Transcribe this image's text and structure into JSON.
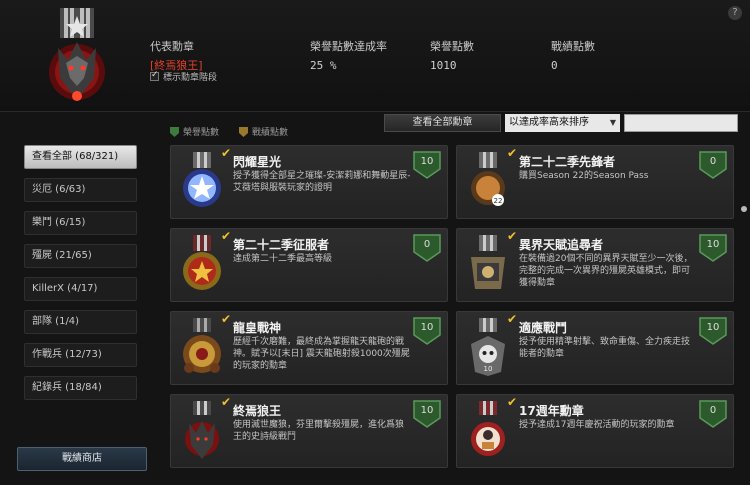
{
  "help": {
    "label": "?"
  },
  "header": {
    "rep_label": "代表勳章",
    "rep_name": "[終焉狼王]",
    "show_level_label": "標示勳章階段",
    "rate_label": "榮譽點數達成率",
    "rate_value": "25 %",
    "points_label": "榮譽點數",
    "points_value": "1010",
    "record_label": "戰績點數",
    "record_value": "0"
  },
  "toolbar": {
    "legend_honor": "榮譽點數",
    "legend_record": "戰績點數",
    "view_all_label": "查看全部勳章",
    "sort_value": "以達成率高來排序"
  },
  "sidebar": {
    "items": [
      {
        "label": "查看全部 (68/321)"
      },
      {
        "label": "災厄 (6/63)"
      },
      {
        "label": "樂鬥 (6/15)"
      },
      {
        "label": "殭屍 (21/65)"
      },
      {
        "label": "KillerX (4/17)"
      },
      {
        "label": "部隊 (1/4)"
      },
      {
        "label": "作戰兵 (12/73)"
      },
      {
        "label": "紀錄兵 (18/84)"
      }
    ],
    "shop_label": "戰績商店"
  },
  "medals": [
    {
      "title": "閃耀星光",
      "desc": "授予獲得全部星之璀璨-安潔莉娜和舞動星辰-艾薇塔與服裝玩家的證明",
      "points": "10"
    },
    {
      "title": "第二十二季先鋒者",
      "desc": "購買Season 22的Season Pass",
      "points": "0"
    },
    {
      "title": "第二十二季征服者",
      "desc": "達成第二十二季最高等級",
      "points": "0"
    },
    {
      "title": "異界天賦追尋者",
      "desc": "在裝備過20個不同的異界天賦至少一次後，完整的完成一次異界的殭屍英雄模式，即可獲得勳章",
      "points": "10"
    },
    {
      "title": "龍皇戰神",
      "desc": "歷經千次磨難，最終成為掌握龍天龍砲的戰神。賦予以[末日] 震天龍砲射殺1000次殭屍的玩家的勳章",
      "points": "10"
    },
    {
      "title": "適應戰鬥",
      "desc": "授予使用精準射擊、致命重傷、全力疾走技能者的勳章",
      "points": "10"
    },
    {
      "title": "終焉狼王",
      "desc": "使用滅世魔狼，芬里爾擊殺殭屍，進化爲狼王的史詩級戰鬥",
      "points": "10"
    },
    {
      "title": "17週年勳章",
      "desc": "授予達成17週年慶祝活動的玩家的勳章",
      "points": "0"
    }
  ],
  "colors": {
    "accent_red": "#e0402a",
    "shield_green": "#3d7a3d",
    "check_gold": "#f0c02e"
  }
}
